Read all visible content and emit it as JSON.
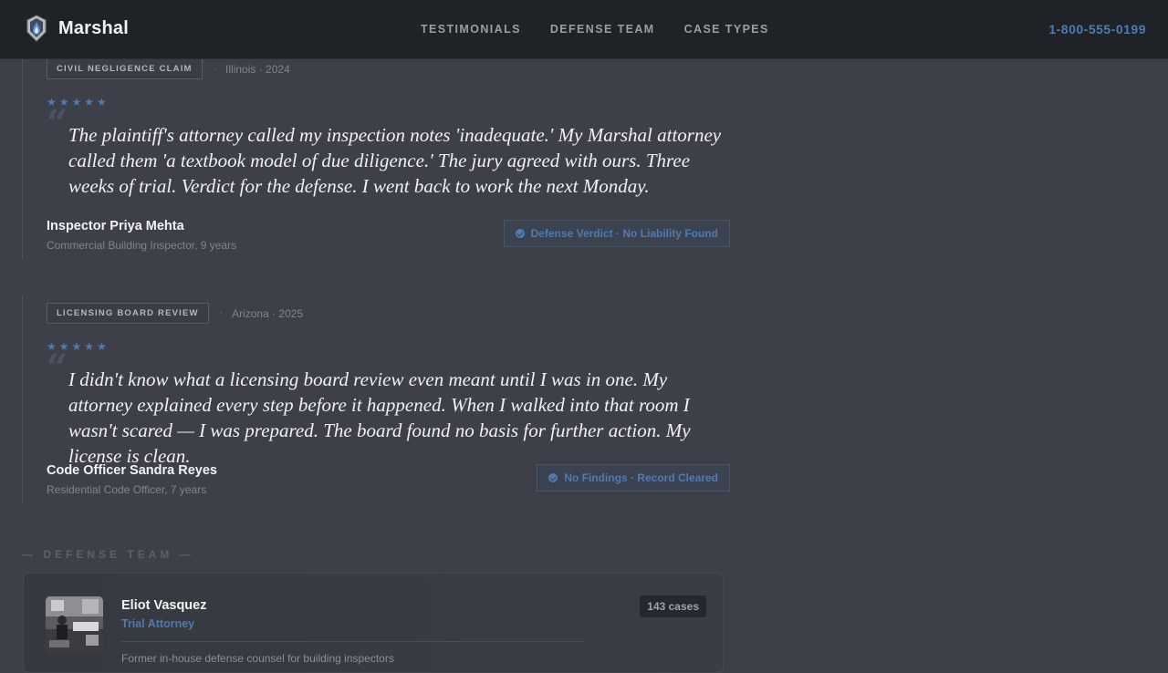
{
  "header": {
    "brand_name": "Marshal",
    "nav": [
      "TESTIMONIALS",
      "DEFENSE TEAM",
      "CASE TYPES"
    ],
    "phone": "1-800-555-0199"
  },
  "testimonials": [
    {
      "case_type": "CIVIL NEGLIGENCE CLAIM",
      "location": "Illinois · 2024",
      "stars": "★★★★★",
      "rating": 5,
      "quote_mark": "“",
      "quote": "The plaintiff's attorney called my inspection notes 'inadequate.' My Marshal attorney called them 'a textbook model of due diligence.' The jury agreed with ours. Three weeks of trial. Verdict for the defense. I went back to work the next Monday.",
      "author_name": "Inspector Priya Mehta",
      "author_role": "Commercial Building Inspector, 9 years",
      "outcome": "Defense Verdict · No Liability Found"
    },
    {
      "case_type": "LICENSING BOARD REVIEW",
      "location": "Arizona · 2025",
      "stars": "★★★★★",
      "rating": 5,
      "quote_mark": "“",
      "quote": "I didn't know what a licensing board review even meant until I was in one. My attorney explained every step before it happened. When I walked into that room I wasn't scared — I was prepared. The board found no basis for further action. My license is clean.",
      "author_name": "Code Officer Sandra Reyes",
      "author_role": "Residential Code Officer, 7 years",
      "outcome": "No Findings · Record Cleared"
    }
  ],
  "team_section": {
    "label": "— DEFENSE TEAM —",
    "members": [
      {
        "name": "Eliot Vasquez",
        "role": "Trial Attorney",
        "cases": "143 cases",
        "snippet": "Former in-house defense counsel for building inspectors"
      }
    ]
  },
  "colors": {
    "background": "#3d4049",
    "header": "#1f2226",
    "accent": "#4f7bb0"
  }
}
